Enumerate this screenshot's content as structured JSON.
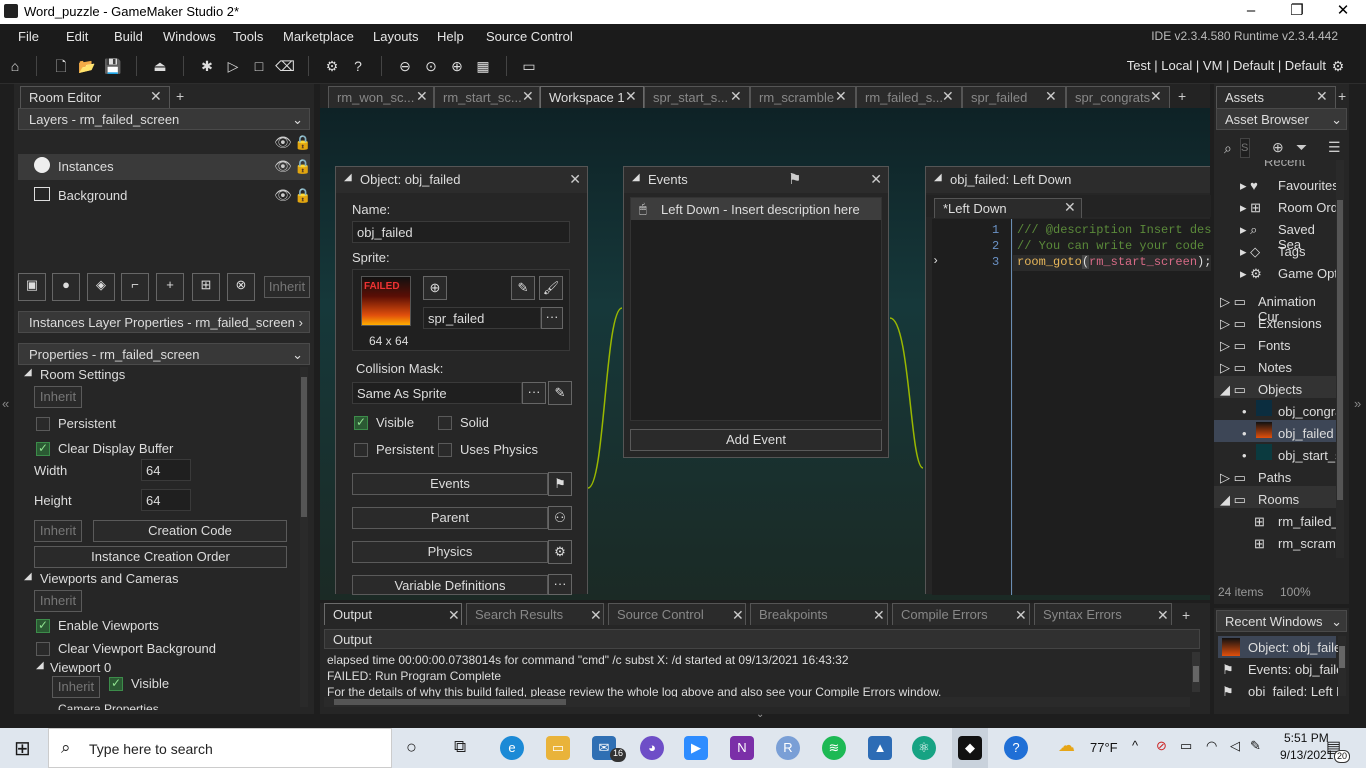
{
  "window": {
    "title": "Word_puzzle - GameMaker Studio 2*",
    "minimize": "–",
    "maximize": "❐",
    "close": "✕"
  },
  "menu": [
    "File",
    "Edit",
    "Build",
    "Windows",
    "Tools",
    "Marketplace",
    "Layouts",
    "Help",
    "Source Control"
  ],
  "versions": "IDE v2.3.4.580  Runtime v2.3.4.442",
  "targets": "Test  |  Local  |  VM  |  Default  |  Default",
  "left": {
    "tab": "Room Editor",
    "add_tab": "+",
    "layers_dropdown": "Layers - rm_failed_screen",
    "layers": [
      "Instances",
      "Background"
    ],
    "inherit_btn": "Inherit",
    "instances_layer_props": "Instances Layer Properties - rm_failed_screen",
    "properties_dropdown": "Properties - rm_failed_screen",
    "room_settings": "Room Settings",
    "inherit": "Inherit",
    "persistent": "Persistent",
    "clear_display_buffer": "Clear Display Buffer",
    "width_label": "Width",
    "width_value": "64",
    "height_label": "Height",
    "height_value": "64",
    "creation_code": "Creation Code",
    "instance_creation_order": "Instance Creation Order",
    "viewports_and_cameras": "Viewports and Cameras",
    "enable_viewports": "Enable Viewports",
    "clear_viewport_background": "Clear Viewport Background",
    "viewport0": "Viewport 0",
    "visible": "Visible",
    "camera_properties": "Camera Properties"
  },
  "tabs": [
    "rm_won_sc...",
    "rm_start_sc...",
    "Workspace 1",
    "spr_start_s...",
    "rm_scramble",
    "rm_failed_s...",
    "spr_failed",
    "spr_congrats"
  ],
  "object_win": {
    "title": "Object: obj_failed",
    "name_label": "Name:",
    "name_value": "obj_failed",
    "sprite_label": "Sprite:",
    "sprite_name": "spr_failed",
    "sprite_size": "64 x 64",
    "sprite_thumb_text": "FAILED",
    "collision_label": "Collision Mask:",
    "collision_value": "Same As Sprite",
    "visible": "Visible",
    "solid": "Solid",
    "persistent": "Persistent",
    "uses_physics": "Uses Physics",
    "events": "Events",
    "parent": "Parent",
    "physics": "Physics",
    "variable_definitions": "Variable Definitions",
    "more": "···"
  },
  "events_win": {
    "title": "Events",
    "event": "Left Down - Insert description here",
    "add_event": "Add Event"
  },
  "code_win": {
    "title": "obj_failed: Left Down",
    "tab": "*Left Down",
    "lines": [
      {
        "n": "1",
        "text": "/// @description Insert desc"
      },
      {
        "n": "2",
        "text": "// You can write your code i"
      },
      {
        "n": "3",
        "fn": "room_goto",
        "open": "(",
        "arg": "rm_start_screen",
        "close": ");"
      }
    ]
  },
  "output": {
    "tabs": [
      "Output",
      "Search Results",
      "Source Control",
      "Breakpoints",
      "Compile Errors",
      "Syntax Errors"
    ],
    "header": "Output",
    "lines": [
      "elapsed time 00:00:00.0738014s for command \"cmd\" /c subst X: /d started at 09/13/2021 16:43:32",
      "FAILED: Run Program Complete",
      "For the details of why this build failed, please review the whole log above and also see your Compile Errors window."
    ]
  },
  "assets": {
    "tab": "Assets",
    "browser": "Asset Browser",
    "search_placeholder": "S",
    "tree": [
      {
        "label": "Recent"
      },
      {
        "label": "Favourites"
      },
      {
        "label": "Room Ord"
      },
      {
        "label": "Saved Sea"
      },
      {
        "label": "Tags"
      },
      {
        "label": "Game Opt"
      },
      {
        "label": "Animation Cur"
      },
      {
        "label": "Extensions"
      },
      {
        "label": "Fonts"
      },
      {
        "label": "Notes"
      },
      {
        "label": "Objects"
      },
      {
        "label": "obj_congra"
      },
      {
        "label": "obj_failed"
      },
      {
        "label": "obj_start_s"
      },
      {
        "label": "Paths"
      },
      {
        "label": "Rooms"
      },
      {
        "label": "rm_failed_"
      },
      {
        "label": "rm_scram"
      }
    ],
    "count": "24 items",
    "zoom": "100%",
    "recent_windows": "Recent Windows",
    "recent": [
      "Object: obj_faile",
      "Events: obj_faile",
      "obj_failed: Left D"
    ]
  },
  "taskbar": {
    "search": "Type here to search",
    "weather": "77°F",
    "time": "5:51 PM",
    "date": "9/13/2021",
    "mail_badge": "16",
    "notif_badge": "20"
  }
}
